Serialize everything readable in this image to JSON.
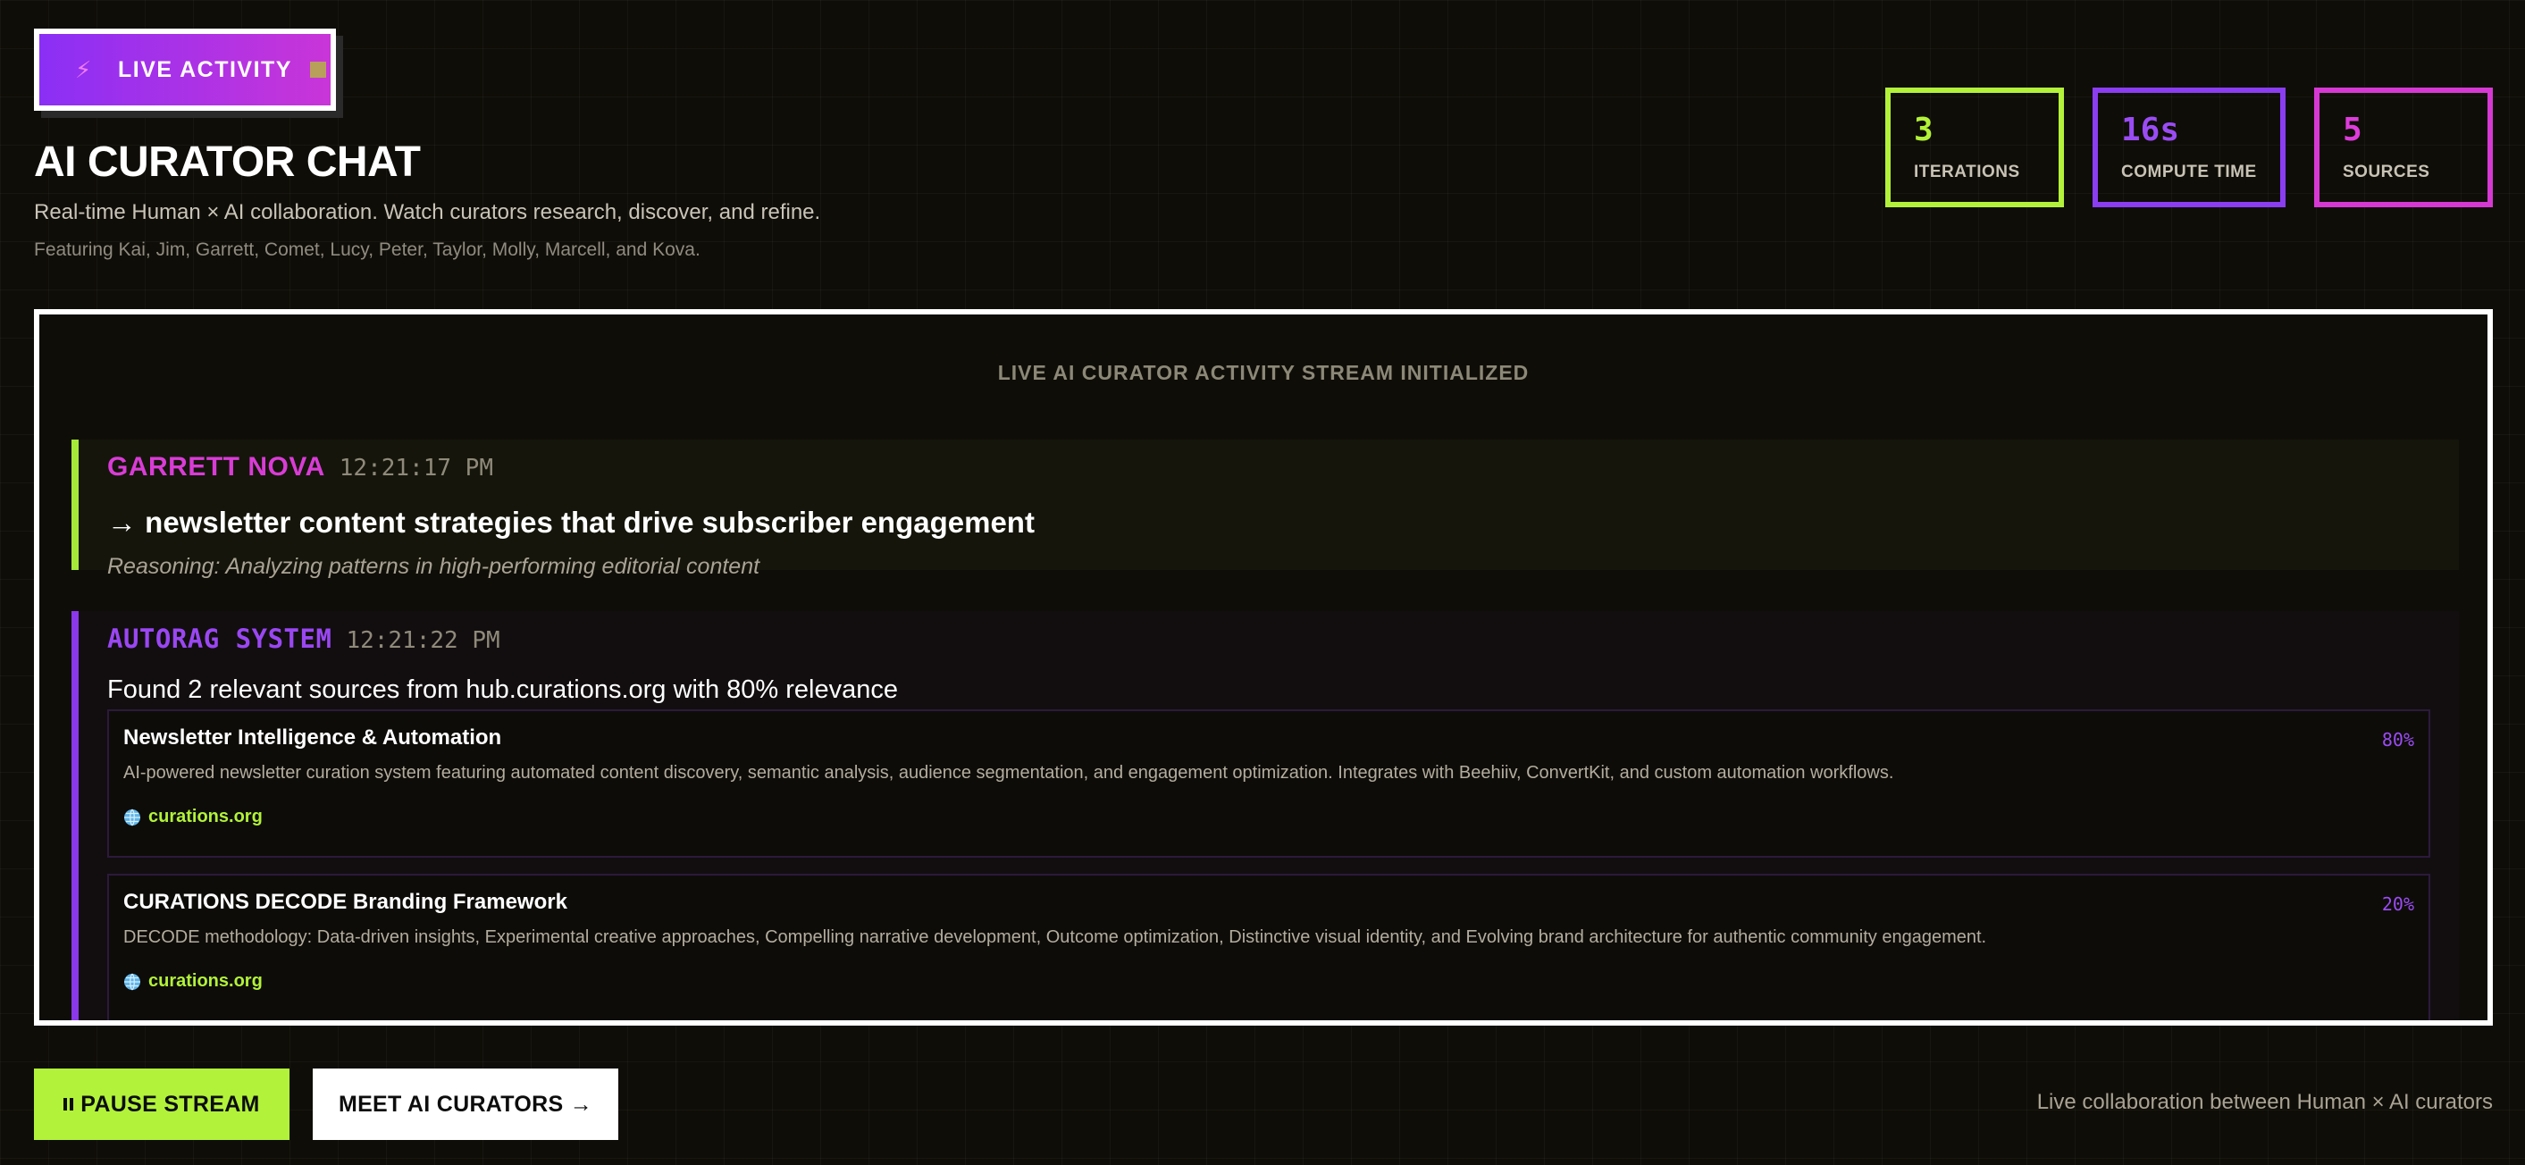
{
  "badge": {
    "label": "LIVE ACTIVITY",
    "icon": "lightning-icon",
    "indicator_icon": "stop-square-icon"
  },
  "header": {
    "title": "AI CURATOR CHAT",
    "subtitle": "Real-time Human × AI collaboration. Watch curators research, discover, and refine.",
    "featuring": "Featuring Kai, Jim, Garrett, Comet, Lucy, Peter, Taylor, Molly, Marcell, and Kova."
  },
  "stats": [
    {
      "value": "3",
      "label": "ITERATIONS",
      "color": "#b2f23a"
    },
    {
      "value": "16s",
      "label": "COMPUTE TIME",
      "color": "#9a4cf4"
    },
    {
      "value": "5",
      "label": "SOURCES",
      "color": "#dd3cdb"
    }
  ],
  "stream": {
    "header": "LIVE AI CURATOR ACTIVITY STREAM INITIALIZED",
    "messages": [
      {
        "author": "GARRETT NOVA",
        "time": "12:21:17 PM",
        "action": "→ newsletter content strategies that drive subscriber engagement",
        "reasoning": "Reasoning: Analyzing patterns in high-performing editorial content",
        "accent": "#a6e83a"
      },
      {
        "author": "AUTORAG SYSTEM",
        "time": "12:21:22 PM",
        "text": "Found 2 relevant sources from hub.curations.org with 80% relevance",
        "accent": "#8a38ea",
        "sources": [
          {
            "title": "Newsletter Intelligence & Automation",
            "relevance": "80%",
            "description": "AI-powered newsletter curation system featuring automated content discovery, semantic analysis, audience segmentation, and engagement optimization. Integrates with Beehiiv, ConvertKit, and custom automation workflows.",
            "domain": "curations.org"
          },
          {
            "title": "CURATIONS DECODE Branding Framework",
            "relevance": "20%",
            "description": "DECODE methodology: Data-driven insights, Experimental creative approaches, Compelling narrative development, Outcome optimization, Distinctive visual identity, and Evolving brand architecture for authentic community engagement.",
            "domain": "curations.org"
          }
        ]
      }
    ]
  },
  "controls": {
    "pause_label": "PAUSE STREAM",
    "meet_label": "MEET AI CURATORS →"
  },
  "footer": {
    "note": "Live collaboration between Human × AI curators"
  },
  "colors": {
    "background": "#0f0d07",
    "lime": "#b2f23a",
    "purple": "#8b3df2",
    "magenta": "#d639d3"
  }
}
